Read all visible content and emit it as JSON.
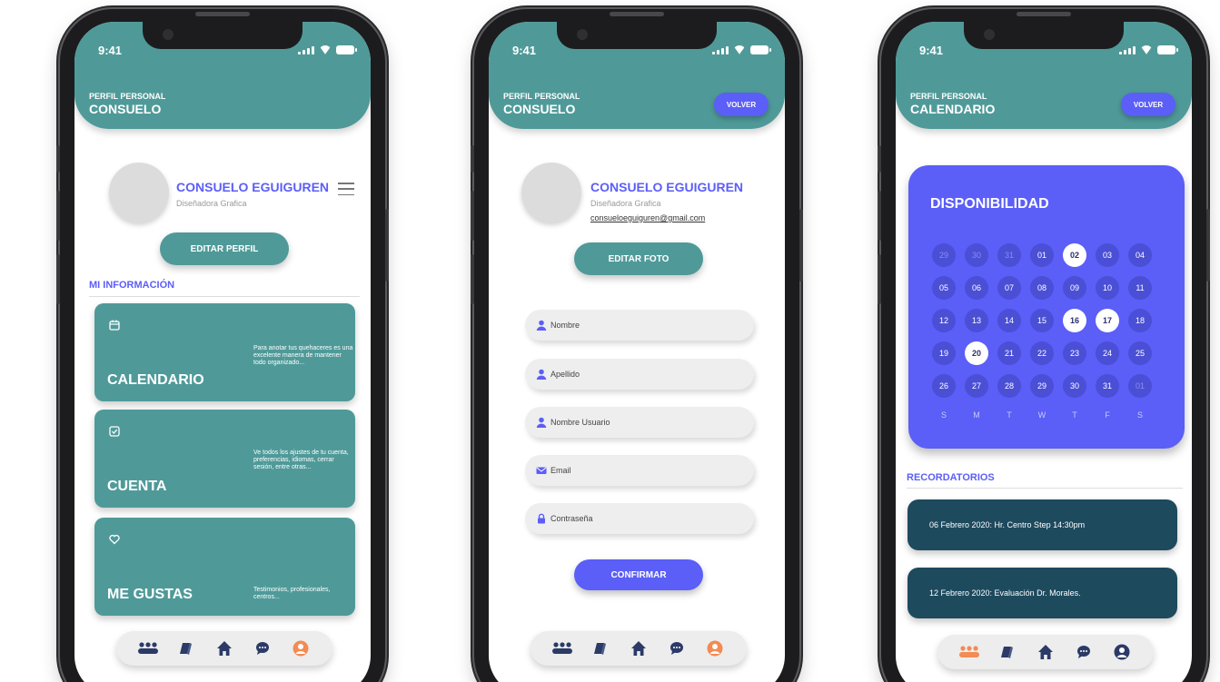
{
  "status": {
    "time": "9:41"
  },
  "colors": {
    "teal": "#4f9a99",
    "blue": "#5b5ef7",
    "navy": "#1e4a5e",
    "orange": "#f28b54"
  },
  "phones": [
    {
      "header_sub": "PERFIL PERSONAL",
      "header_title": "CONSUELO",
      "profile_name": "CONSUELO EGUIGUREN",
      "profile_role": "Diseñadora Grafica",
      "edit_button": "EDITAR PERFIL",
      "section_title": "MI INFORMACIÓN",
      "cards": [
        {
          "title": "CALENDARIO",
          "desc": "Para anotar tus quehaceres es una excelente manera de mantener todo organizado...",
          "icon": "calendar-icon"
        },
        {
          "title": "CUENTA",
          "desc": "Ve todos los ajustes de tu cuenta, preferencias, idiomas, cerrar sesión, entre otras...",
          "icon": "checkbox-icon"
        },
        {
          "title": "ME GUSTAS",
          "desc": "Testimonios, profesionales, centros...",
          "icon": "heart-icon"
        }
      ],
      "nav_active": "profile"
    },
    {
      "header_sub": "PERFIL PERSONAL",
      "header_title": "CONSUELO",
      "back_button": "VOLVER",
      "profile_name": "CONSUELO EGUIGUREN",
      "profile_role": "Diseñadora Grafica",
      "profile_email": "consueloeguiguren@gmail.com",
      "edit_button": "EDITAR FOTO",
      "fields": [
        {
          "label": "Nombre",
          "icon": "user-icon"
        },
        {
          "label": "Apellido",
          "icon": "user-icon"
        },
        {
          "label": "Nombre Usuario",
          "icon": "user-icon"
        },
        {
          "label": "Email",
          "icon": "mail-icon"
        },
        {
          "label": "Contraseña",
          "icon": "lock-icon"
        }
      ],
      "confirm_button": "CONFIRMAR",
      "nav_active": "profile"
    },
    {
      "header_sub": "PERFIL PERSONAL",
      "header_title": "CALENDARIO",
      "back_button": "VOLVER",
      "calendar_title": "DISPONIBILIDAD",
      "days": [
        {
          "d": "29",
          "s": "muted"
        },
        {
          "d": "30",
          "s": "muted"
        },
        {
          "d": "31",
          "s": "muted"
        },
        {
          "d": "01",
          "s": ""
        },
        {
          "d": "02",
          "s": "sel"
        },
        {
          "d": "03",
          "s": ""
        },
        {
          "d": "04",
          "s": ""
        },
        {
          "d": "05",
          "s": ""
        },
        {
          "d": "06",
          "s": ""
        },
        {
          "d": "07",
          "s": ""
        },
        {
          "d": "08",
          "s": ""
        },
        {
          "d": "09",
          "s": ""
        },
        {
          "d": "10",
          "s": ""
        },
        {
          "d": "11",
          "s": ""
        },
        {
          "d": "12",
          "s": ""
        },
        {
          "d": "13",
          "s": ""
        },
        {
          "d": "14",
          "s": ""
        },
        {
          "d": "15",
          "s": ""
        },
        {
          "d": "16",
          "s": "sel"
        },
        {
          "d": "17",
          "s": "sel"
        },
        {
          "d": "18",
          "s": ""
        },
        {
          "d": "19",
          "s": ""
        },
        {
          "d": "20",
          "s": "sel"
        },
        {
          "d": "21",
          "s": ""
        },
        {
          "d": "22",
          "s": ""
        },
        {
          "d": "23",
          "s": ""
        },
        {
          "d": "24",
          "s": ""
        },
        {
          "d": "25",
          "s": ""
        },
        {
          "d": "26",
          "s": ""
        },
        {
          "d": "27",
          "s": ""
        },
        {
          "d": "28",
          "s": ""
        },
        {
          "d": "29",
          "s": ""
        },
        {
          "d": "30",
          "s": ""
        },
        {
          "d": "31",
          "s": ""
        },
        {
          "d": "01",
          "s": "muted"
        }
      ],
      "weekdays": [
        "S",
        "M",
        "T",
        "W",
        "T",
        "F",
        "S"
      ],
      "section_title": "RECORDATORIOS",
      "reminders": [
        "06 Febrero 2020:  Hr. Centro Step 14:30pm",
        "12 Febrero 2020: Evaluación  Dr. Morales."
      ],
      "nav_active": "community"
    }
  ],
  "nav_items": [
    "community-icon",
    "book-icon",
    "home-icon",
    "chat-icon",
    "profile-icon"
  ]
}
